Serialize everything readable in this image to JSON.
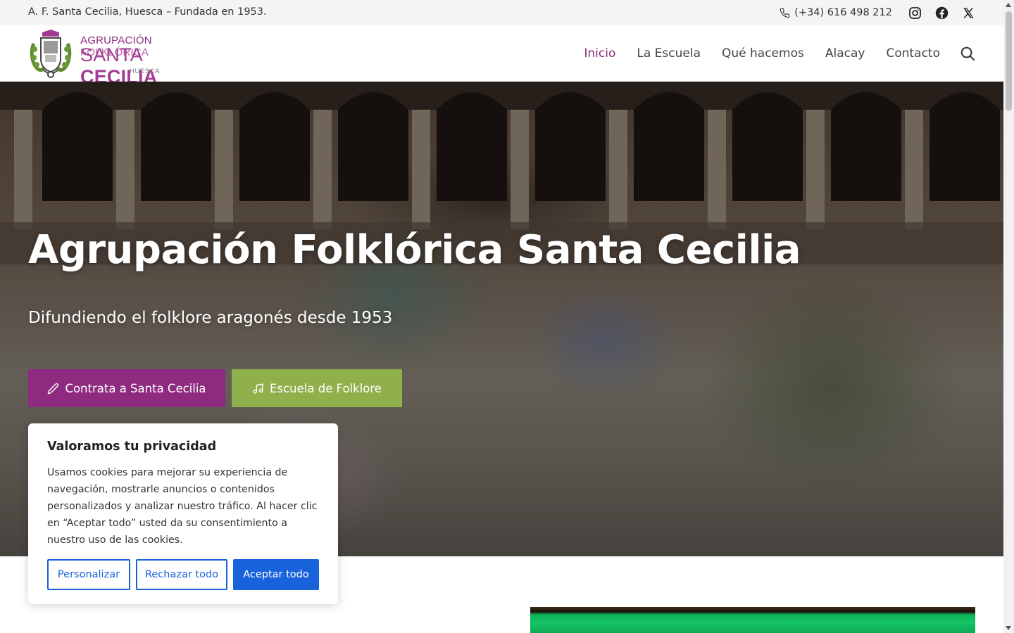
{
  "topbar": {
    "tagline": "A. F. Santa Cecilia, Huesca – Fundada en 1953.",
    "phone": "(+34) 616 498 212",
    "social": [
      "instagram-icon",
      "facebook-icon",
      "x-icon"
    ]
  },
  "logo": {
    "line1_a": "AGRUPACIÓN",
    "line1_b": "FOLKLÓRICA",
    "line2_a": "SANTA",
    "line2_b": "CECILIA",
    "line3": "HUESCA"
  },
  "nav": {
    "items": [
      {
        "label": "Inicio",
        "active": true
      },
      {
        "label": "La Escuela",
        "active": false
      },
      {
        "label": "Qué hacemos",
        "active": false
      },
      {
        "label": "Alacay",
        "active": false
      },
      {
        "label": "Contacto",
        "active": false
      }
    ]
  },
  "hero": {
    "title": "Agrupación Folklórica Santa Cecilia",
    "subtitle": "Difundiendo el folklore aragonés desde 1953",
    "btn_contrata": "Contrata a Santa Cecilia",
    "btn_escuela": "Escuela de Folklore"
  },
  "cookie": {
    "title": "Valoramos tu privacidad",
    "body": "Usamos cookies para mejorar su experiencia de navegación, mostrarle anuncios o contenidos personalizados y analizar nuestro tráfico. Al hacer clic en “Aceptar todo” usted da su consentimiento a nuestro uso de las cookies.",
    "btn_custom": "Personalizar",
    "btn_reject": "Rechazar todo",
    "btn_accept": "Aceptar todo"
  },
  "colors": {
    "brand_purple": "#8e2a7f",
    "brand_green": "#8fb04a",
    "accent_blue": "#1863dc"
  }
}
